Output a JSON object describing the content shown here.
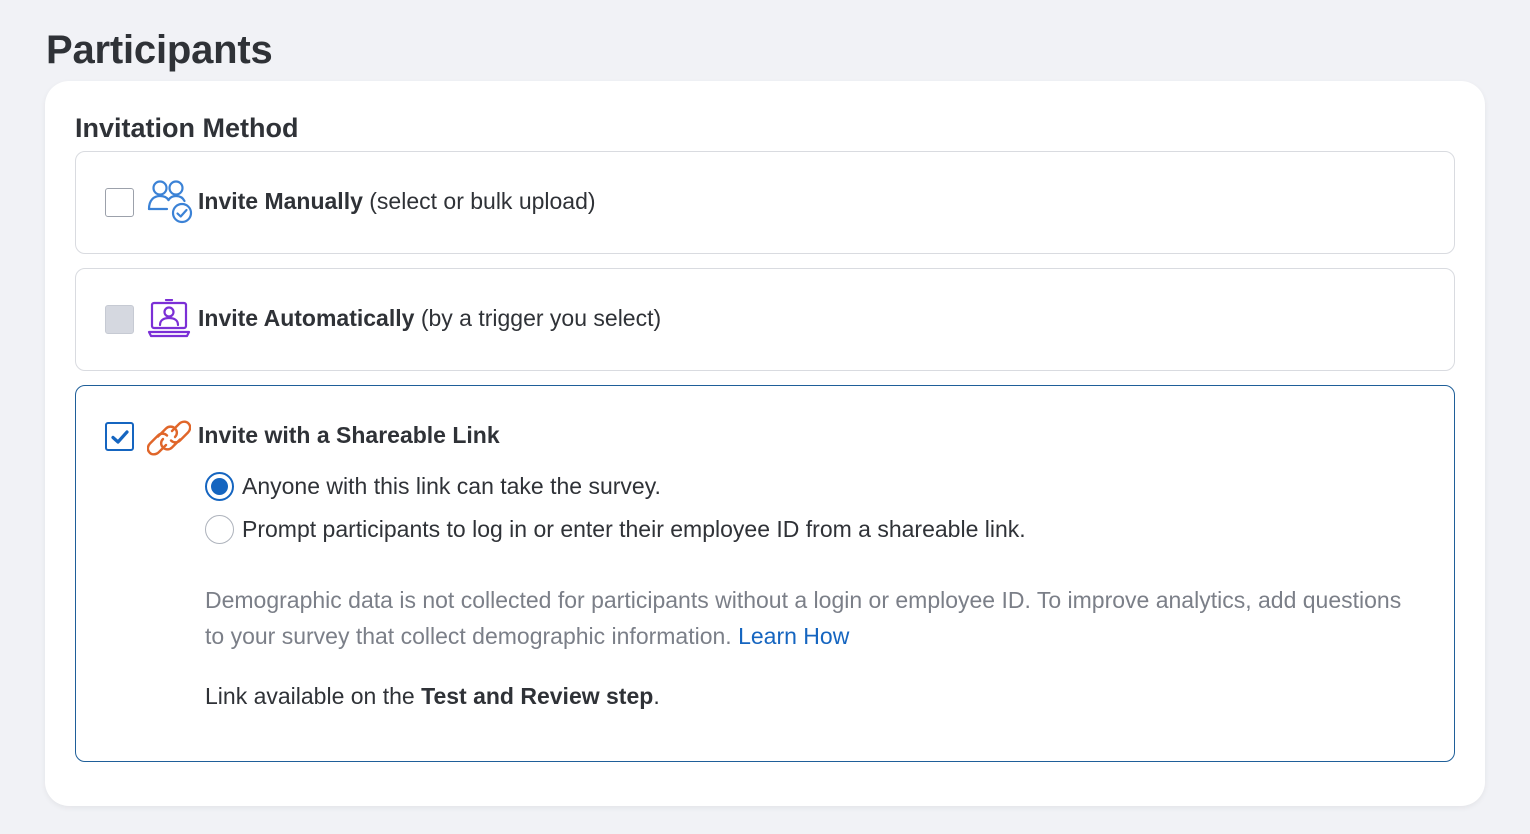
{
  "page": {
    "title": "Participants"
  },
  "invitation": {
    "section_title": "Invitation Method",
    "options": [
      {
        "label_bold": "Invite Manually",
        "label_rest": " (select or bulk upload)",
        "checked": false,
        "disabled": false,
        "icon": "users-check-icon"
      },
      {
        "label_bold": "Invite Automatically",
        "label_rest": " (by a trigger you select)",
        "checked": false,
        "disabled": true,
        "icon": "laptop-user-icon"
      },
      {
        "label_bold": "Invite with a Shareable Link",
        "label_rest": "",
        "checked": true,
        "disabled": false,
        "icon": "link-icon"
      }
    ],
    "link_options": [
      {
        "label": "Anyone with this link can take the survey.",
        "selected": true
      },
      {
        "label": "Prompt participants to log in or enter their employee ID from a shareable link.",
        "selected": false
      }
    ],
    "note_text": "Demographic data is not collected for participants without a login or employee ID. To improve analytics, add questions to your survey that collect demographic information. ",
    "note_link": "Learn How",
    "availability_prefix": "Link available on the ",
    "availability_bold": "Test and Review step",
    "availability_suffix": "."
  },
  "colors": {
    "accent": "#1565c0",
    "manual_icon": "#3b82d6",
    "auto_icon": "#7b2fd6",
    "link_icon": "#e0662a",
    "muted_text": "#7b7f88",
    "background": "#f1f2f6"
  }
}
